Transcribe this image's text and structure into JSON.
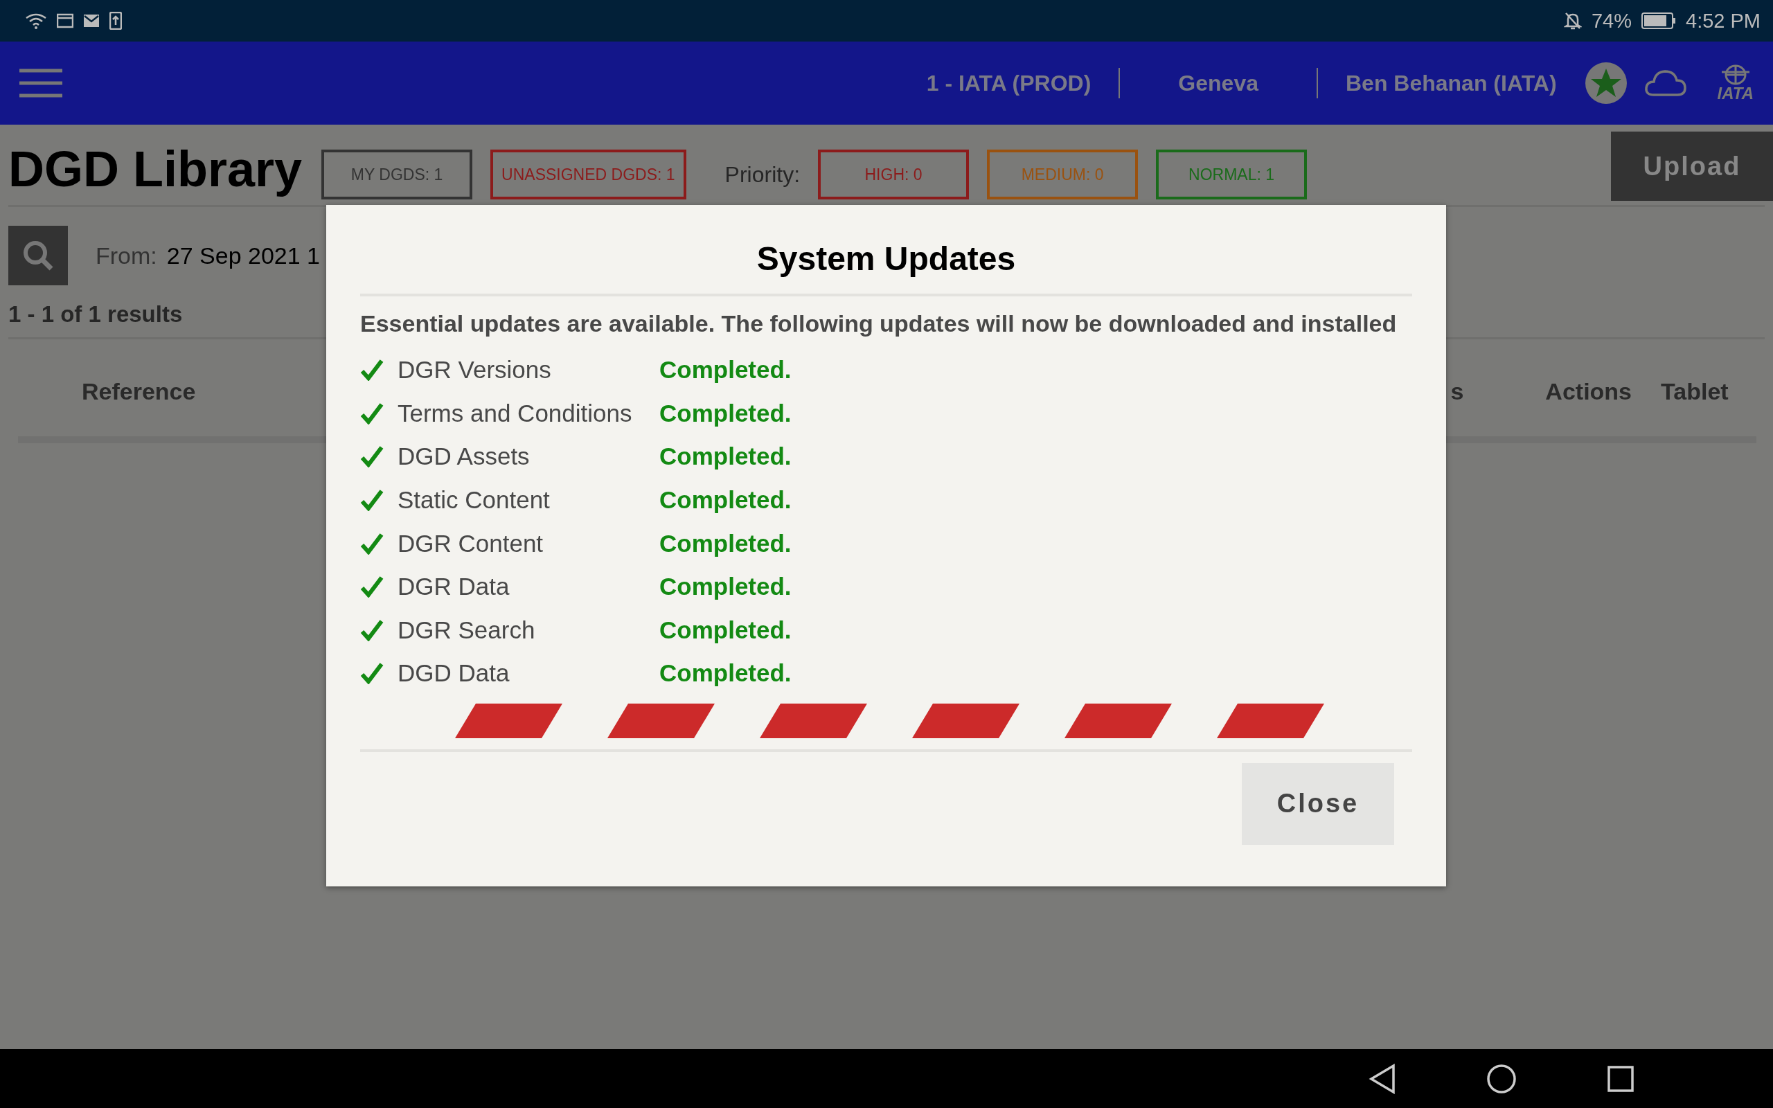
{
  "status_bar": {
    "battery": "74%",
    "time": "4:52 PM"
  },
  "header": {
    "environment": "1 - IATA (PROD)",
    "location": "Geneva",
    "user": "Ben Behanan (IATA)",
    "logo_text": "IATA"
  },
  "page": {
    "title": "DGD Library",
    "filters": [
      {
        "label": "MY DGDS: 1",
        "color": "#333333"
      },
      {
        "label": "UNASSIGNED DGDS: 1",
        "color": "#8c1b1b"
      }
    ],
    "priority_label": "Priority:",
    "priorities": [
      {
        "label": "HIGH: 0",
        "color": "#8c1b1b"
      },
      {
        "label": "MEDIUM: 0",
        "color": "#9a5210"
      },
      {
        "label": "NORMAL: 1",
        "color": "#1a6b1a"
      }
    ],
    "upload": "Upload",
    "from_label": "From:",
    "from_value": "27 Sep 2021 1",
    "results": "1 - 1 of 1 results",
    "columns": [
      "Reference",
      "s",
      "Actions",
      "Tablet"
    ]
  },
  "dialog": {
    "title": "System Updates",
    "message": "Essential updates are available. The following updates will now be downloaded and installed",
    "updates": [
      {
        "name": "DGR Versions",
        "status": "Completed.",
        "done": true
      },
      {
        "name": "Terms and Conditions",
        "status": "Completed.",
        "done": true
      },
      {
        "name": "DGD Assets",
        "status": "Completed.",
        "done": true
      },
      {
        "name": "Static Content",
        "status": "Completed.",
        "done": true
      },
      {
        "name": "DGR Content",
        "status": "Completed.",
        "done": true
      },
      {
        "name": "DGR Data",
        "status": "Completed.",
        "done": true
      },
      {
        "name": "DGR Search",
        "status": "Completed.",
        "done": true
      },
      {
        "name": "DGD Data",
        "status": "Completed.",
        "done": true
      }
    ],
    "close": "Close"
  }
}
